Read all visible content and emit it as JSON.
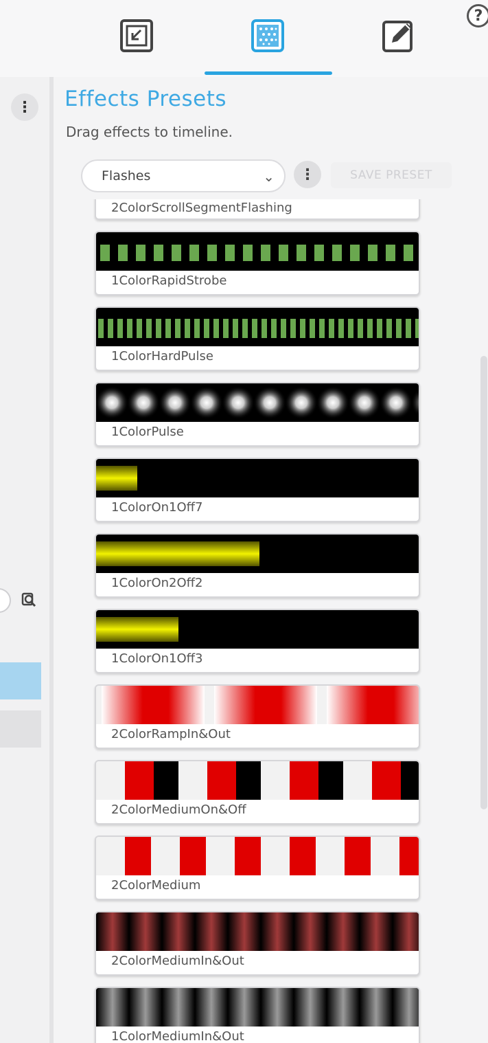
{
  "tabs": [
    {
      "name": "tab-import",
      "icon": "import-icon"
    },
    {
      "name": "tab-effects-presets",
      "icon": "effects-icon",
      "active": true
    },
    {
      "name": "tab-edit",
      "icon": "edit-icon"
    }
  ],
  "help_label": "?",
  "panel": {
    "title": "Effects Presets",
    "subtitle": "Drag effects to timeline.",
    "category_select": "Flashes",
    "save_preset_label": "SAVE PRESET"
  },
  "presets": [
    {
      "label": "2ColorScrollSegmentFlashing"
    },
    {
      "label": "1ColorRapidStrobe"
    },
    {
      "label": "1ColorHardPulse"
    },
    {
      "label": "1ColorPulse"
    },
    {
      "label": "1ColorOn1Off7"
    },
    {
      "label": "1ColorOn2Off2"
    },
    {
      "label": "1ColorOn1Off3"
    },
    {
      "label": "2ColorRampIn&Out"
    },
    {
      "label": "2ColorMediumOn&Off"
    },
    {
      "label": "2ColorMedium"
    },
    {
      "label": "2ColorMediumIn&Out"
    },
    {
      "label": "1ColorMediumIn&Out"
    }
  ],
  "colors": {
    "accent": "#3fa9e3",
    "strobe_green": "#6aa84f",
    "yellow": "#e8e800",
    "red": "#e00000"
  }
}
